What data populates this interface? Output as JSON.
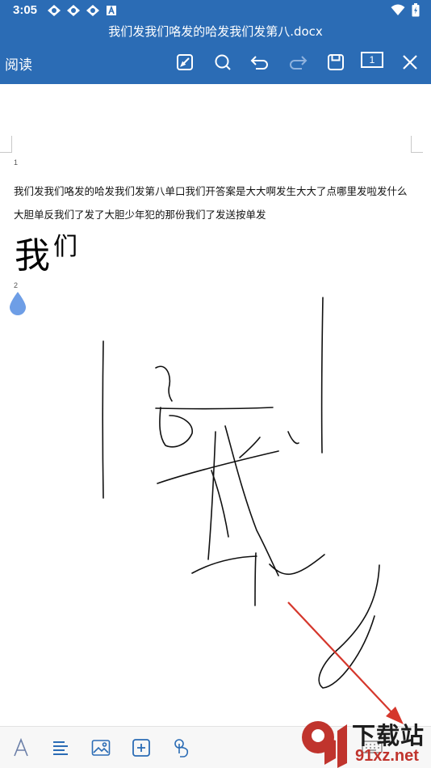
{
  "status_bar": {
    "time": "3:05",
    "notification_icons": [
      "app-icon",
      "app-icon",
      "app-icon",
      "a-icon"
    ],
    "right_icons": [
      "wifi-icon",
      "battery-icon"
    ]
  },
  "document": {
    "filename": "我们发我们咯发的哈发我们发第八.docx"
  },
  "toolbar": {
    "read_label": "阅读",
    "buttons": [
      "edit-icon",
      "search-icon",
      "undo-icon",
      "redo-icon",
      "save-icon",
      "page-count",
      "close-icon"
    ],
    "page_count": "1",
    "accent": "#2b6cb5"
  },
  "content": {
    "para1_number": "1",
    "line1": "我们发我们咯发的哈发我们发第八单口我们开答案是大大啊发生大大了点哪里发啦发什么",
    "line2": "大胆单反我们了发了大胆少年犯的那份我们了发送按单发",
    "heading_big": "我",
    "heading_small": "们",
    "para2_number": "2"
  },
  "bottom_toolbar": {
    "buttons": [
      "font-icon",
      "paragraph-icon",
      "image-icon",
      "insert-icon",
      "touch-icon",
      "keyboard-icon"
    ]
  },
  "watermark": {
    "logo_text": "9",
    "site_name": "下载站",
    "site_url": "91xz.net",
    "brand_color": "#c0342d"
  }
}
